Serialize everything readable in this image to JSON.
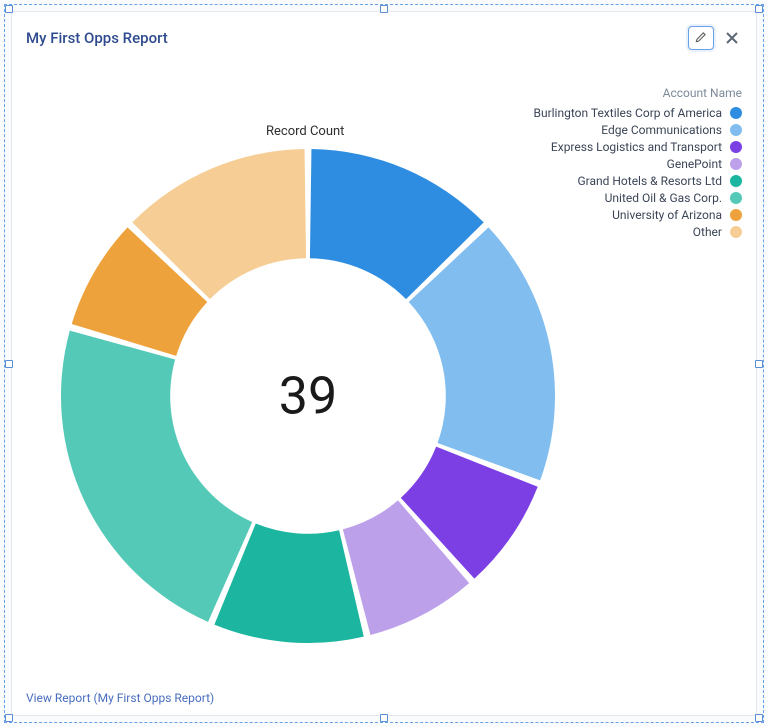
{
  "header": {
    "title": "My First Opps Report"
  },
  "legend": {
    "title": "Account Name",
    "items": [
      {
        "label": "Burlington Textiles Corp of America",
        "color": "#2e8de0"
      },
      {
        "label": "Edge Communications",
        "color": "#81bdee"
      },
      {
        "label": "Express Logistics and Transport",
        "color": "#7b3fe4"
      },
      {
        "label": "GenePoint",
        "color": "#bda0ea"
      },
      {
        "label": "Grand Hotels & Resorts Ltd",
        "color": "#1cb59f"
      },
      {
        "label": "United Oil & Gas Corp.",
        "color": "#54c9b7"
      },
      {
        "label": "University of Arizona",
        "color": "#eea23b"
      },
      {
        "label": "Other",
        "color": "#f6ce95"
      }
    ]
  },
  "chart_data": {
    "type": "pie",
    "title": "Record Count",
    "center_value": "39",
    "series": [
      {
        "name": "Burlington Textiles Corp of America",
        "value": 5,
        "color": "#2e8de0"
      },
      {
        "name": "Edge Communications",
        "value": 7,
        "color": "#81bdee"
      },
      {
        "name": "Express Logistics and Transport",
        "value": 3,
        "color": "#7b3fe4"
      },
      {
        "name": "GenePoint",
        "value": 3,
        "color": "#bda0ea"
      },
      {
        "name": "Grand Hotels & Resorts Ltd",
        "value": 4,
        "color": "#1cb59f"
      },
      {
        "name": "United Oil & Gas Corp.",
        "value": 9,
        "color": "#54c9b7"
      },
      {
        "name": "University of Arizona",
        "value": 3,
        "color": "#eea23b"
      },
      {
        "name": "Other",
        "value": 5,
        "color": "#f6ce95"
      }
    ]
  },
  "footer": {
    "link_text": "View Report (My First Opps Report)"
  }
}
